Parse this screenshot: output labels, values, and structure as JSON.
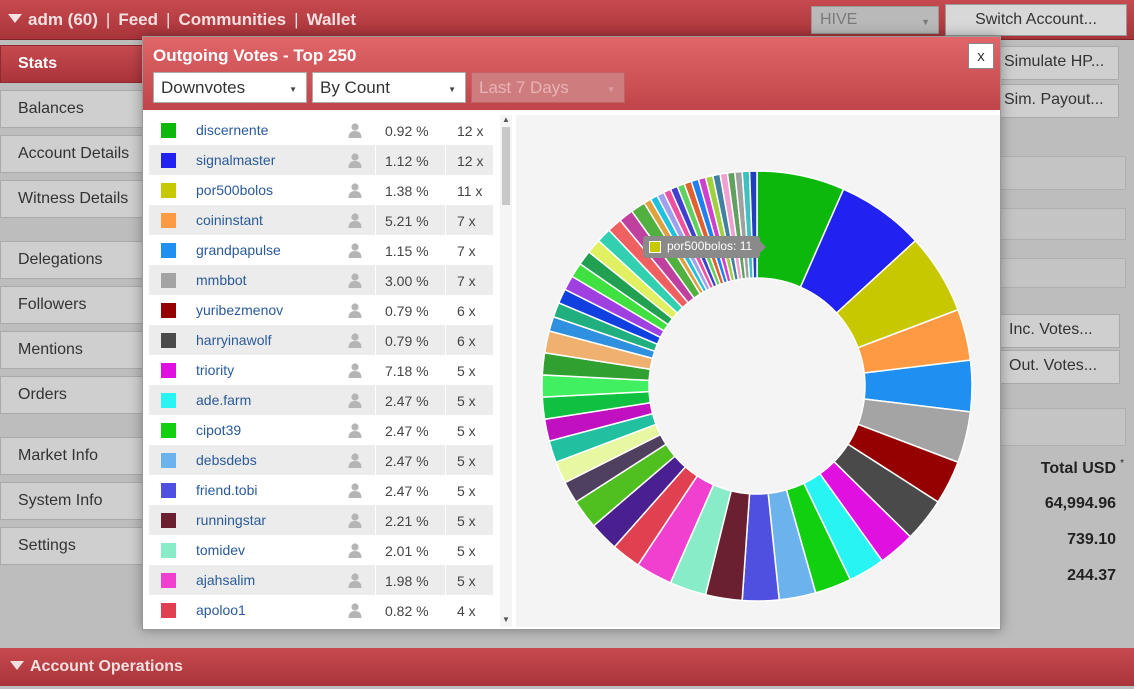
{
  "topbar": {
    "user": "adm (60)",
    "links": [
      "Feed",
      "Communities",
      "Wallet"
    ],
    "chain_select": "HIVE",
    "switch_account": "Switch Account..."
  },
  "sidebar": {
    "items": [
      {
        "label": "Stats"
      },
      {
        "label": "Balances"
      },
      {
        "label": "Account Details"
      },
      {
        "label": "Witness Details"
      },
      {
        "label": "Delegations"
      },
      {
        "label": "Followers"
      },
      {
        "label": "Mentions"
      },
      {
        "label": "Orders"
      },
      {
        "label": "Market Info"
      },
      {
        "label": "System Info"
      },
      {
        "label": "Settings"
      }
    ]
  },
  "background": {
    "simulate_hp": "Simulate HP...",
    "sim_payout": "Sim. Payout...",
    "inc_votes": "Inc. Votes...",
    "out_votes": "Out. Votes...",
    "total_usd_label": "Total USD",
    "total_usd_marker": "*",
    "values": [
      "64,994.96",
      "739.10",
      "244.37"
    ],
    "account_operations": "Account Operations"
  },
  "modal": {
    "title": "Outgoing Votes - Top 250",
    "close": "x",
    "vote_type": "Downvotes",
    "sort": "By Count",
    "period": "Last 7 Days",
    "rows": [
      {
        "name": "discernente",
        "pct": "0.92 %",
        "count": "12 x",
        "color": "#0cb80c"
      },
      {
        "name": "signalmaster",
        "pct": "1.12 %",
        "count": "12 x",
        "color": "#2222f0"
      },
      {
        "name": "por500bolos",
        "pct": "1.38 %",
        "count": "11 x",
        "color": "#c8c800"
      },
      {
        "name": "coininstant",
        "pct": "5.21 %",
        "count": "7 x",
        "color": "#ff9a44"
      },
      {
        "name": "grandpapulse",
        "pct": "1.15 %",
        "count": "7 x",
        "color": "#1f8ff2"
      },
      {
        "name": "mmbbot",
        "pct": "3.00 %",
        "count": "7 x",
        "color": "#a4a4a4"
      },
      {
        "name": "yuribezmenov",
        "pct": "0.79 %",
        "count": "6 x",
        "color": "#950000"
      },
      {
        "name": "harryinawolf",
        "pct": "0.79 %",
        "count": "6 x",
        "color": "#4a4a4a"
      },
      {
        "name": "triority",
        "pct": "7.18 %",
        "count": "5 x",
        "color": "#e010e0"
      },
      {
        "name": "ade.farm",
        "pct": "2.47 %",
        "count": "5 x",
        "color": "#28f4f4"
      },
      {
        "name": "cipot39",
        "pct": "2.47 %",
        "count": "5 x",
        "color": "#10d010"
      },
      {
        "name": "debsdebs",
        "pct": "2.47 %",
        "count": "5 x",
        "color": "#6cb2ec"
      },
      {
        "name": "friend.tobi",
        "pct": "2.47 %",
        "count": "5 x",
        "color": "#5050e0"
      },
      {
        "name": "runningstar",
        "pct": "2.21 %",
        "count": "5 x",
        "color": "#6a2030"
      },
      {
        "name": "tomidev",
        "pct": "2.01 %",
        "count": "5 x",
        "color": "#88ecc8"
      },
      {
        "name": "ajahsalim",
        "pct": "1.98 %",
        "count": "5 x",
        "color": "#f040d0"
      },
      {
        "name": "apoloo1",
        "pct": "0.82 %",
        "count": "4 x",
        "color": "#e04050"
      }
    ],
    "tooltip": "por500bolos: 11",
    "tooltip_color": "#c8c800"
  },
  "chart_data": {
    "type": "pie",
    "donut": true,
    "labels": [
      "discernente",
      "signalmaster",
      "por500bolos",
      "coininstant",
      "grandpapulse",
      "mmbbot",
      "yuribezmenov",
      "harryinawolf",
      "triority",
      "ade.farm",
      "cipot39",
      "debsdebs",
      "friend.tobi",
      "runningstar",
      "tomidev",
      "ajahsalim",
      "apoloo1"
    ],
    "values": [
      12,
      12,
      11,
      7,
      7,
      7,
      6,
      6,
      5,
      5,
      5,
      5,
      5,
      5,
      5,
      5,
      4
    ],
    "colors": [
      "#0cb80c",
      "#2222f0",
      "#c8c800",
      "#ff9a44",
      "#1f8ff2",
      "#a4a4a4",
      "#950000",
      "#4a4a4a",
      "#e010e0",
      "#28f4f4",
      "#10d010",
      "#6cb2ec",
      "#5050e0",
      "#6a2030",
      "#88ecc8",
      "#f040d0",
      "#e04050"
    ],
    "tail_values": [
      4,
      4,
      3,
      3,
      3,
      3,
      3,
      3,
      3,
      3,
      2,
      2,
      2,
      2,
      2,
      2,
      2,
      2,
      2,
      2,
      2,
      1,
      1,
      1,
      1,
      1,
      1,
      1,
      1,
      1,
      1,
      1,
      1,
      1,
      1,
      1,
      1
    ],
    "tail_colors": [
      "#4a2090",
      "#50c020",
      "#504060",
      "#e8f8a0",
      "#20c0a0",
      "#c010c0",
      "#10c040",
      "#40f060",
      "#30a030",
      "#f0b070",
      "#3090e0",
      "#20b080",
      "#1040e0",
      "#a040e0",
      "#40e040",
      "#20a050",
      "#e0f060",
      "#30d0b0",
      "#f06060",
      "#c040a0",
      "#50b040",
      "#e0a040",
      "#20c0e0",
      "#a0a0f0",
      "#f050a0",
      "#4040d0",
      "#60d060",
      "#e06030",
      "#2080f0",
      "#d040d0",
      "#a0d040",
      "#4080a0",
      "#f0a0d0",
      "#60a060",
      "#a0a0a0",
      "#40c0c0",
      "#2040c0"
    ]
  }
}
